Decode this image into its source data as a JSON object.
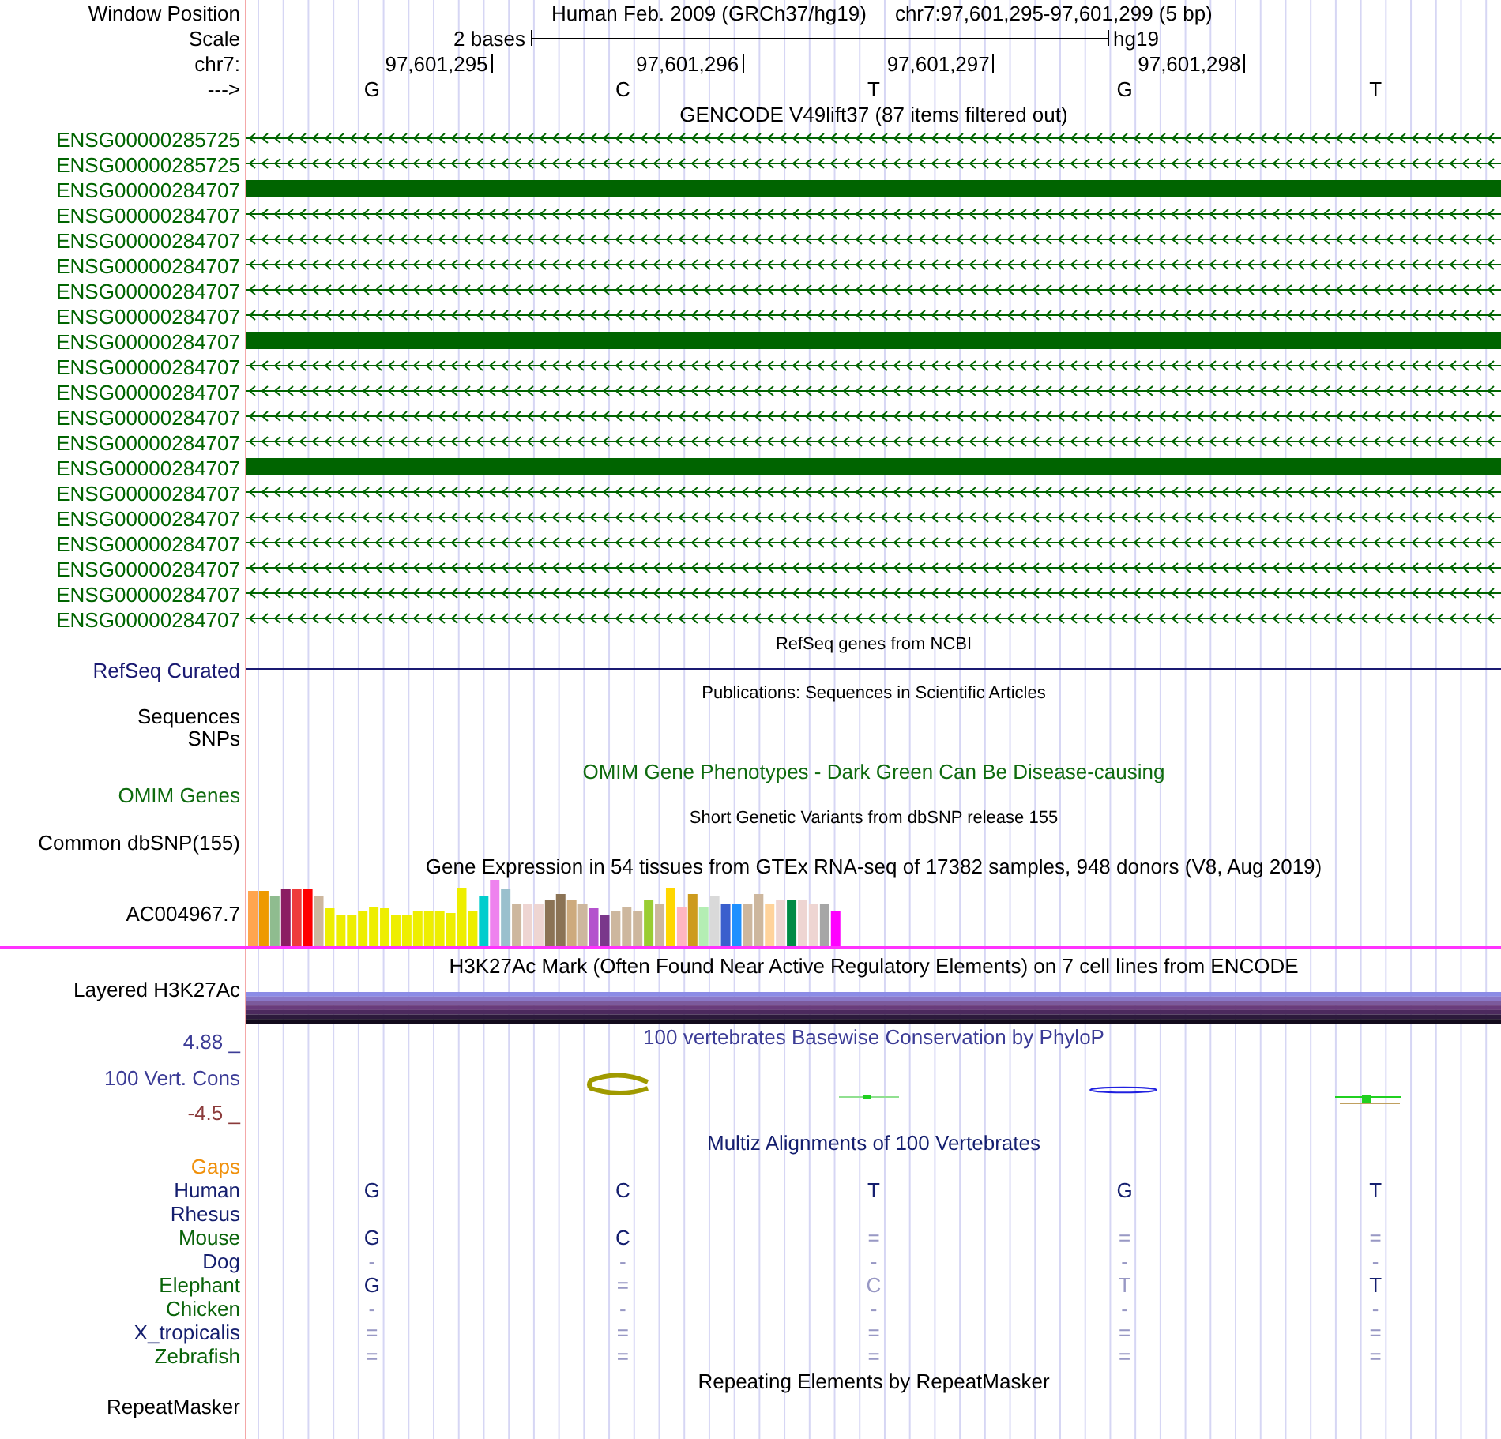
{
  "position": {
    "label": "Window Position",
    "assembly": "Human Feb. 2009 (GRCh37/hg19)",
    "range": "chr7:97,601,295-97,601,299 (5 bp)"
  },
  "scale": {
    "label": "Scale",
    "length": "2 bases",
    "assembly": "hg19"
  },
  "ruler": {
    "label": "chr7:",
    "ticks": [
      "97,601,295",
      "97,601,296",
      "97,601,297",
      "97,601,298"
    ]
  },
  "strand": {
    "label": "--->",
    "bases": [
      "G",
      "C",
      "T",
      "G",
      "T"
    ]
  },
  "gencode": {
    "title": "GENCODE V49lift37 (87 items filtered out)",
    "items": [
      {
        "name": "ENSG00000285725",
        "kind": "intron"
      },
      {
        "name": "ENSG00000285725",
        "kind": "intron"
      },
      {
        "name": "ENSG00000284707",
        "kind": "exon"
      },
      {
        "name": "ENSG00000284707",
        "kind": "intron"
      },
      {
        "name": "ENSG00000284707",
        "kind": "intron"
      },
      {
        "name": "ENSG00000284707",
        "kind": "intron"
      },
      {
        "name": "ENSG00000284707",
        "kind": "intron"
      },
      {
        "name": "ENSG00000284707",
        "kind": "intron"
      },
      {
        "name": "ENSG00000284707",
        "kind": "exon"
      },
      {
        "name": "ENSG00000284707",
        "kind": "intron"
      },
      {
        "name": "ENSG00000284707",
        "kind": "intron"
      },
      {
        "name": "ENSG00000284707",
        "kind": "intron"
      },
      {
        "name": "ENSG00000284707",
        "kind": "intron"
      },
      {
        "name": "ENSG00000284707",
        "kind": "exon"
      },
      {
        "name": "ENSG00000284707",
        "kind": "intron"
      },
      {
        "name": "ENSG00000284707",
        "kind": "intron"
      },
      {
        "name": "ENSG00000284707",
        "kind": "intron"
      },
      {
        "name": "ENSG00000284707",
        "kind": "intron"
      },
      {
        "name": "ENSG00000284707",
        "kind": "intron"
      },
      {
        "name": "ENSG00000284707",
        "kind": "intron"
      }
    ]
  },
  "refseq": {
    "title": "RefSeq genes from NCBI",
    "label": "RefSeq Curated"
  },
  "publications": {
    "title": "Publications: Sequences in Scientific Articles",
    "labels": [
      "Sequences",
      "SNPs"
    ]
  },
  "omim": {
    "title": "OMIM Gene Phenotypes - Dark Green Can Be Disease-causing",
    "label": "OMIM Genes"
  },
  "dbsnp": {
    "title": "Short Genetic Variants from dbSNP release 155",
    "label": "Common dbSNP(155)"
  },
  "gtex": {
    "title": "Gene Expression in 54 tissues from GTEx RNA-seq of 17382 samples, 948 donors (V8, Aug 2019)",
    "label": "AC004967.7",
    "bars": [
      {
        "color": "#ffa54f"
      },
      {
        "color": "#ee9a00"
      },
      {
        "color": "#8fbc8f"
      },
      {
        "color": "#8b1c62"
      },
      {
        "color": "#ee3b3b"
      },
      {
        "color": "#ff0000"
      },
      {
        "color": "#cdb79e"
      },
      {
        "color": "#eeee00"
      },
      {
        "color": "#eeee00"
      },
      {
        "color": "#eeee00"
      },
      {
        "color": "#eeee00"
      },
      {
        "color": "#eeee00"
      },
      {
        "color": "#eeee00"
      },
      {
        "color": "#eeee00"
      },
      {
        "color": "#eeee00"
      },
      {
        "color": "#eeee00"
      },
      {
        "color": "#eeee00"
      },
      {
        "color": "#eeee00"
      },
      {
        "color": "#eeee00"
      },
      {
        "color": "#eeee00"
      },
      {
        "color": "#eeee00"
      },
      {
        "color": "#00cdcd"
      },
      {
        "color": "#ee82ee"
      },
      {
        "color": "#9ac0cd"
      },
      {
        "color": "#cdb79e"
      },
      {
        "color": "#eed5d2"
      },
      {
        "color": "#eed5d2"
      },
      {
        "color": "#8b7355"
      },
      {
        "color": "#8b7355"
      },
      {
        "color": "#cdaa7d"
      },
      {
        "color": "#cdb79e"
      },
      {
        "color": "#b452cd"
      },
      {
        "color": "#7a378b"
      },
      {
        "color": "#cdb79e"
      },
      {
        "color": "#cdb79e"
      },
      {
        "color": "#cdb79e"
      },
      {
        "color": "#9acd32"
      },
      {
        "color": "#cdb79e"
      },
      {
        "color": "#ffd700"
      },
      {
        "color": "#ffb6c1"
      },
      {
        "color": "#cd9b1d"
      },
      {
        "color": "#b4eeb4"
      },
      {
        "color": "#d9d9d9"
      },
      {
        "color": "#3a5fcd"
      },
      {
        "color": "#1e90ff"
      },
      {
        "color": "#cdb79e"
      },
      {
        "color": "#cdb79e"
      },
      {
        "color": "#ffd39b"
      },
      {
        "color": "#eed5d2"
      },
      {
        "color": "#008b45"
      },
      {
        "color": "#eed5d2"
      },
      {
        "color": "#eed5d2"
      },
      {
        "color": "#a6a6a6"
      },
      {
        "color": "#ff00ff"
      }
    ]
  },
  "h3k27ac": {
    "title": "H3K27Ac Mark (Often Found Near Active Regulatory Elements) on 7 cell lines from ENCODE",
    "label": "Layered H3K27Ac"
  },
  "conservation": {
    "title": "100 vertebrates Basewise Conservation by PhyloP",
    "label": "100 Vert. Cons",
    "max": "4.88 _",
    "min": "-4.5 _"
  },
  "multiz": {
    "title": "Multiz Alignments of 100 Vertebrates",
    "species": [
      {
        "name": "Gaps",
        "color": "#f0900a"
      },
      {
        "name": "Human",
        "color": "#141e6e",
        "cells": [
          {
            "text": "G",
            "faded": false
          },
          {
            "text": "C",
            "faded": false
          },
          {
            "text": "T",
            "faded": false
          },
          {
            "text": "G",
            "faded": false
          },
          {
            "text": "T",
            "faded": false
          }
        ]
      },
      {
        "name": "Rhesus",
        "color": "#141e6e"
      },
      {
        "name": "Mouse",
        "color": "#0a640a",
        "cells": [
          {
            "text": "G",
            "faded": false
          },
          {
            "text": "C",
            "faded": false
          },
          {
            "text": "=",
            "faded": true
          },
          {
            "text": "=",
            "faded": true
          },
          {
            "text": "=",
            "faded": true
          }
        ]
      },
      {
        "name": "Dog",
        "color": "#141e6e",
        "cells": [
          {
            "text": "-",
            "faded": true
          },
          {
            "text": "-",
            "faded": true
          },
          {
            "text": "-",
            "faded": true
          },
          {
            "text": "-",
            "faded": true
          },
          {
            "text": "-",
            "faded": true
          }
        ]
      },
      {
        "name": "Elephant",
        "color": "#0a640a",
        "cells": [
          {
            "text": "G",
            "faded": false
          },
          {
            "text": "=",
            "faded": true
          },
          {
            "text": "C",
            "faded": true
          },
          {
            "text": "T",
            "faded": true
          },
          {
            "text": "T",
            "faded": false
          }
        ]
      },
      {
        "name": "Chicken",
        "color": "#0a640a",
        "cells": [
          {
            "text": "-",
            "faded": true
          },
          {
            "text": "-",
            "faded": true
          },
          {
            "text": "-",
            "faded": true
          },
          {
            "text": "-",
            "faded": true
          },
          {
            "text": "-",
            "faded": true
          }
        ]
      },
      {
        "name": "X_tropicalis",
        "color": "#141e6e",
        "cells": [
          {
            "text": "=",
            "faded": true
          },
          {
            "text": "=",
            "faded": true
          },
          {
            "text": "=",
            "faded": true
          },
          {
            "text": "=",
            "faded": true
          },
          {
            "text": "=",
            "faded": true
          }
        ]
      },
      {
        "name": "Zebrafish",
        "color": "#0a640a",
        "cells": [
          {
            "text": "=",
            "faded": true
          },
          {
            "text": "=",
            "faded": true
          },
          {
            "text": "=",
            "faded": true
          },
          {
            "text": "=",
            "faded": true
          },
          {
            "text": "=",
            "faded": true
          }
        ]
      }
    ]
  },
  "repeats": {
    "title": "Repeating Elements by RepeatMasker",
    "label": "RepeatMasker"
  }
}
